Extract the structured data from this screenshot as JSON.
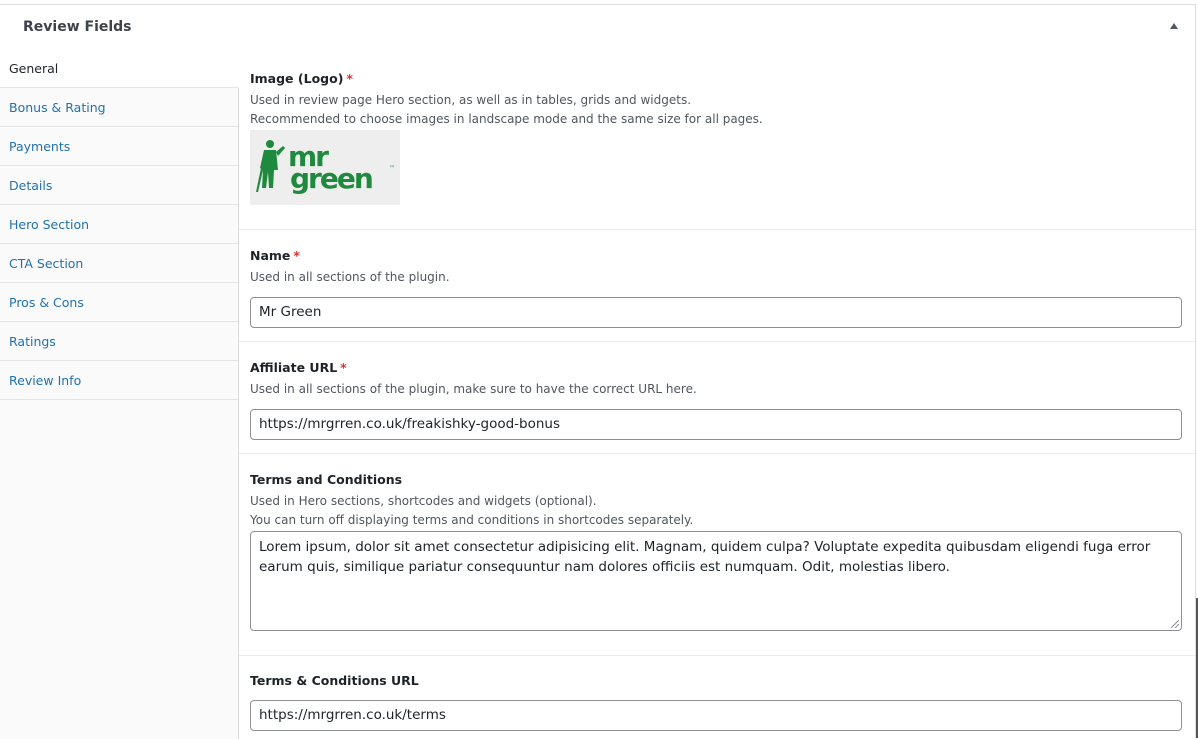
{
  "panel": {
    "title": "Review Fields"
  },
  "sidebar": {
    "items": [
      {
        "label": "General"
      },
      {
        "label": "Bonus & Rating"
      },
      {
        "label": "Payments"
      },
      {
        "label": "Details"
      },
      {
        "label": "Hero Section"
      },
      {
        "label": "CTA Section"
      },
      {
        "label": "Pros & Cons"
      },
      {
        "label": "Ratings"
      },
      {
        "label": "Review Info"
      }
    ]
  },
  "fields": {
    "logo": {
      "label": "Image (Logo)",
      "required": "*",
      "desc1": "Used in review page Hero section, as well as in tables, grids and widgets.",
      "desc2": "Recommended to choose images in landscape mode and the same size for all pages.",
      "logo_text_top": "mr",
      "logo_text_bottom": "green",
      "logo_tm": "™",
      "logo_color": "#1f8a3d"
    },
    "name": {
      "label": "Name",
      "required": "*",
      "desc": "Used in all sections of the plugin.",
      "value": "Mr Green"
    },
    "affiliate": {
      "label": "Affiliate URL",
      "required": "*",
      "desc": "Used in all sections of the plugin, make sure to have the correct URL here.",
      "value": "https://mrgrren.co.uk/freakishky-good-bonus"
    },
    "terms": {
      "label": "Terms and Conditions",
      "desc1": "Used in Hero sections, shortcodes and widgets (optional).",
      "desc2": "You can turn off displaying terms and conditions in shortcodes separately.",
      "value": "Lorem ipsum, dolor sit amet consectetur adipisicing elit. Magnam, quidem culpa? Voluptate expedita quibusdam eligendi fuga error earum quis, similique pariatur consequuntur nam dolores officiis est numquam. Odit, molestias libero."
    },
    "terms_url": {
      "label": "Terms & Conditions URL",
      "value": "https://mrgrren.co.uk/terms"
    }
  },
  "colors": {
    "link": "#2271b1",
    "required": "#d63638"
  }
}
